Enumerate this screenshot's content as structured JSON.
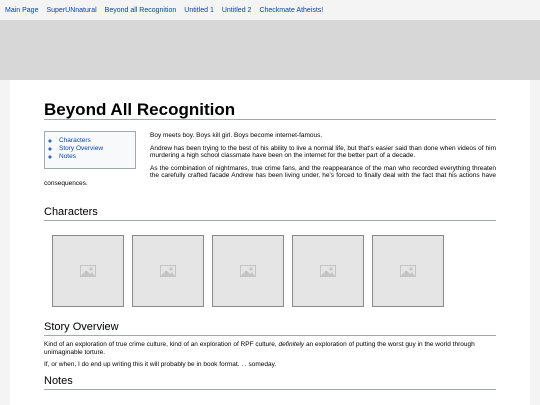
{
  "nav": {
    "links": [
      "Main Page",
      "SuperUNnatural",
      "Beyond all Recognition",
      "Untitled 1",
      "Untitled 2",
      "Checkmate Atheists!"
    ]
  },
  "colors": {
    "link": "#0645ad",
    "banner": "#d7d7d7",
    "nav_bg": "#f4f4f4"
  },
  "page": {
    "title": "Beyond All Recognition",
    "toc": [
      "Characters",
      "Story Overview",
      "Notes"
    ],
    "intro": [
      "Boy meets boy. Boys kill girl. Boys become internet-famous.",
      "Andrew has been trying to the best of his ability to live a normal life, but that's easier said than done when videos of him murdering a high school classmate have been on the internet for the better part of a decade.",
      "As the combination of nightmares, true crime fans, and the reappearance of the man who recorded everything threaten the carefully crafted facade Andrew has been living under, he's forced to finally deal with the fact that his actions have consequences."
    ],
    "characters": {
      "heading": "Characters",
      "thumbnails": [
        "image-placeholder-icon",
        "image-placeholder-icon",
        "image-placeholder-icon",
        "image-placeholder-icon",
        "image-placeholder-icon"
      ]
    },
    "story": {
      "heading": "Story Overview",
      "p1_before": "Kind of an exploration of true crime culture, kind of an exploration of RPF culture, ",
      "p1_em": "definitely",
      "p1_after": " an exploration of putting the worst guy in the world through unimaginable torture.",
      "p2": "If, or when, I do end up writing this it will probably be in book format. . . someday."
    },
    "notes": {
      "heading": "Notes"
    }
  }
}
